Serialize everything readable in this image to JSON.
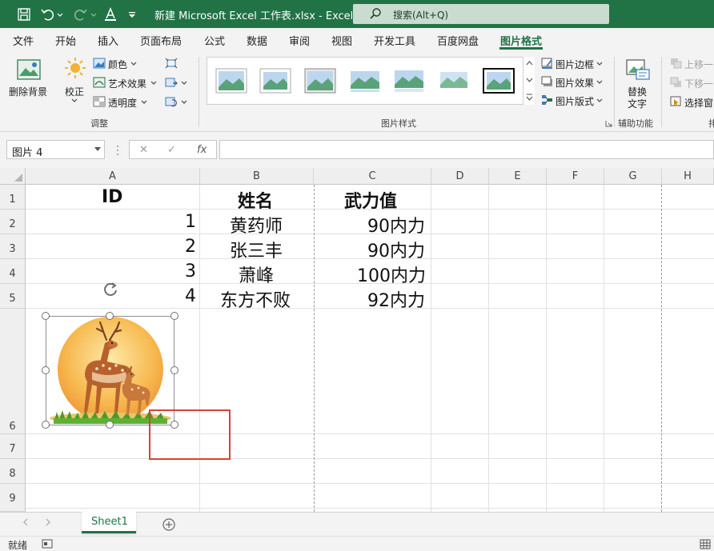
{
  "title_bar": {
    "title": "新建 Microsoft Excel 工作表.xlsx  -  Excel",
    "search_placeholder": "搜索(Alt+Q)"
  },
  "menu_tabs": [
    {
      "label": "文件"
    },
    {
      "label": "开始"
    },
    {
      "label": "插入"
    },
    {
      "label": "页面布局"
    },
    {
      "label": "公式"
    },
    {
      "label": "数据"
    },
    {
      "label": "审阅"
    },
    {
      "label": "视图"
    },
    {
      "label": "开发工具"
    },
    {
      "label": "百度网盘"
    },
    {
      "label": "图片格式",
      "active": true
    }
  ],
  "ribbon": {
    "remove_bg": "删除背景",
    "corrections": "校正",
    "color": "颜色",
    "artistic": "艺术效果",
    "transparency": "透明度",
    "adjust_group": "调整",
    "picture_border": "图片边框",
    "picture_effects": "图片效果",
    "picture_layout": "图片版式",
    "styles_group": "图片样式",
    "alt_text_line1": "替换",
    "alt_text_line2": "文字",
    "accessibility_group": "辅助功能",
    "bring_forward": "上移一",
    "send_backward": "下移一",
    "selection_pane": "选择窗",
    "arrange_group_cut": "排"
  },
  "formula_bar": {
    "name_box": "图片 4",
    "cancel": "✕",
    "enter": "✓",
    "fx": "fx",
    "formula": ""
  },
  "columns": [
    "A",
    "B",
    "C",
    "D",
    "E",
    "F",
    "G",
    "H"
  ],
  "rows": [
    "1",
    "2",
    "3",
    "4",
    "5",
    "6",
    "7",
    "8",
    "9"
  ],
  "table": {
    "headers": [
      "ID",
      "姓名",
      "武力值"
    ],
    "rows": [
      [
        "1",
        "黄药师",
        "90内力"
      ],
      [
        "2",
        "张三丰",
        "90内力"
      ],
      [
        "3",
        "萧峰",
        "100内力"
      ],
      [
        "4",
        "东方不败",
        "92内力"
      ]
    ]
  },
  "sheets": [
    {
      "label": "Sheet1",
      "active": true
    }
  ],
  "status": {
    "text": "就绪"
  },
  "colors": {
    "accent": "#217346",
    "highlight": "#d9413a"
  }
}
